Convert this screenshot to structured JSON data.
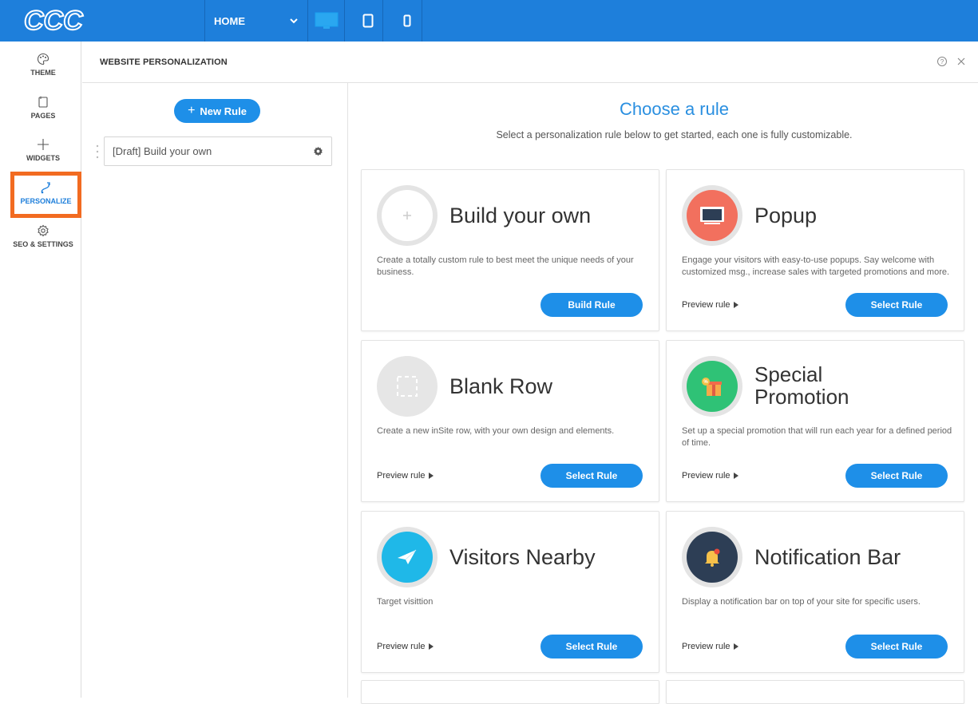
{
  "topbar": {
    "logo_text": "CCC",
    "page_select": "HOME",
    "devices": [
      "desktop-icon",
      "tablet-icon",
      "mobile-icon"
    ]
  },
  "leftnav": {
    "items": [
      {
        "label": "THEME",
        "icon": "palette-icon"
      },
      {
        "label": "PAGES",
        "icon": "pages-icon"
      },
      {
        "label": "WIDGETS",
        "icon": "plus-icon"
      },
      {
        "label": "PERSONALIZE",
        "icon": "personalize-icon",
        "active": true
      },
      {
        "label": "SEO & SETTINGS",
        "icon": "gear-icon"
      }
    ]
  },
  "header": {
    "title": "WEBSITE PERSONALIZATION"
  },
  "rules": {
    "new_rule_label": "New Rule",
    "items": [
      {
        "label": "[Draft] Build your own"
      }
    ]
  },
  "main": {
    "title": "Choose a rule",
    "subtitle": "Select a personalization rule below to get started, each one is fully customizable.",
    "cards": [
      {
        "title": "Build your own",
        "desc": "Create a totally custom rule to best meet the unique needs of your business.",
        "preview": "",
        "button": "Build Rule",
        "icon": "plus-icon"
      },
      {
        "title": "Popup",
        "desc": "Engage your visitors with easy-to-use popups. Say welcome with customized msg., increase sales with targeted promotions and more.",
        "preview": "Preview rule",
        "button": "Select Rule",
        "icon": "popup-icon"
      },
      {
        "title": "Blank Row",
        "desc": "Create a new inSite row, with your own design and elements.",
        "preview": "Preview rule",
        "button": "Select Rule",
        "icon": "blank-row-icon"
      },
      {
        "title_line1": "Special",
        "title_line2": "Promotion",
        "desc": "Set up a special promotion that will run each year for a defined period of time.",
        "preview": "Preview rule",
        "button": "Select Rule",
        "icon": "gift-icon"
      },
      {
        "title": "Visitors Nearby",
        "desc": "Target visittion",
        "preview": "Preview rule",
        "button": "Select Rule",
        "icon": "paper-plane-icon"
      },
      {
        "title": "Notification Bar",
        "desc": "Display a notification bar on top of your site for specific users.",
        "preview": "Preview rule",
        "button": "Select Rule",
        "icon": "bell-icon"
      }
    ]
  },
  "colors": {
    "brand_blue": "#1e7fdb",
    "accent_blue": "#1e8fe8",
    "highlight_orange": "#f26b21",
    "popup_red": "#f2705e",
    "promo_green": "#2fc276",
    "nearby_cyan": "#1fb8e8",
    "notif_navy": "#2d3e55"
  }
}
